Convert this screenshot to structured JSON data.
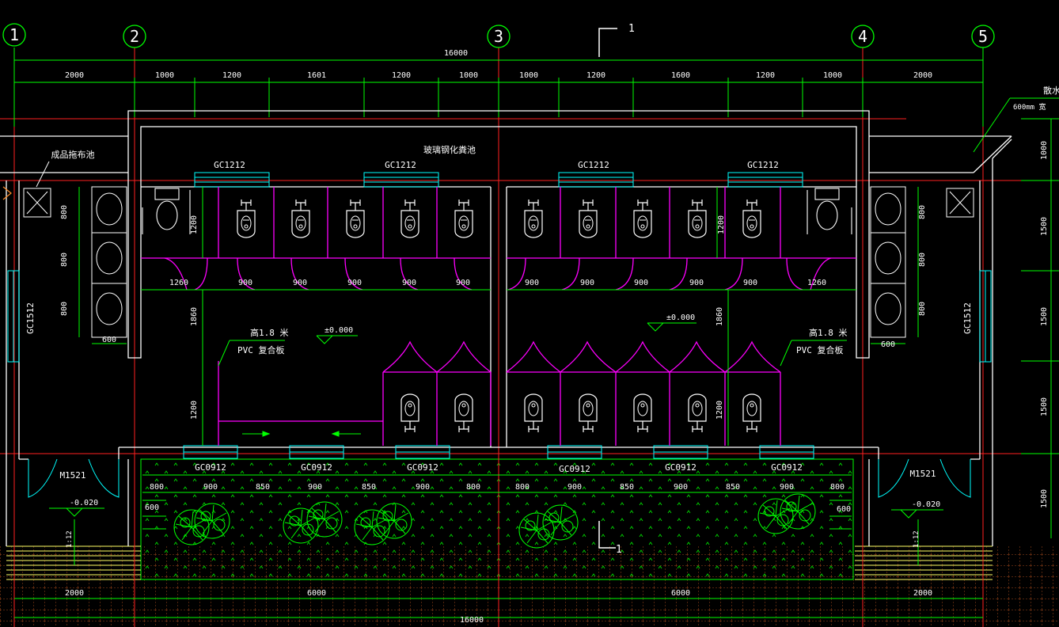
{
  "drawing": {
    "grid_labels": [
      "1",
      "2",
      "3",
      "4",
      "5"
    ],
    "section_mark": "1",
    "overall_dimension": "16000",
    "top_dimensions": [
      "2000",
      "1000",
      "1200",
      "1601",
      "1200",
      "1000",
      "1000",
      "1200",
      "1600",
      "1200",
      "1000",
      "2000"
    ],
    "bottom_dimensions": [
      "2000",
      "6000",
      "6000",
      "2000"
    ],
    "overall_dimension_bottom": "16000",
    "septic_tank_label": "玻璃钢化粪池",
    "top_windows": [
      "GC1212",
      "GC1212",
      "GC1212",
      "GC1212"
    ],
    "bottom_windows": [
      "GC0912",
      "GC0912",
      "GC0912",
      "GC0912",
      "GC0912",
      "GC0912"
    ],
    "side_windows": [
      "GC1512",
      "GC1512"
    ],
    "doors": [
      "M1521",
      "M1521"
    ],
    "mop_sink_label": "成品拖布池",
    "partition_note_line1": "高1.8 米",
    "partition_note_line2": "PVC 复合板",
    "partition_note_right_line1": "高1.8 米",
    "partition_note_right_line2": "PVC 复合板",
    "floor_level": "±0.000",
    "floor_level_right": "±0.000",
    "entrance_level": "-0.020",
    "entrance_level_right": "-0.020",
    "ramp_note": "1:12",
    "stall_widths_left": [
      "1260",
      "900",
      "900",
      "900",
      "900",
      "900"
    ],
    "stall_widths_right": [
      "900",
      "900",
      "900",
      "900",
      "900",
      "1260"
    ],
    "stall_depth": "1200",
    "stall_depth_right": "1200",
    "aisle_depth": "1860",
    "aisle_depth_right": "1860",
    "bottom_stall_depth": "1200",
    "bottom_stall_depth_right": "1200",
    "basin_spacing_left": [
      "800",
      "800",
      "800"
    ],
    "basin_spacing_right": [
      "800",
      "800",
      "800"
    ],
    "basin_width": "600",
    "basin_width_right": "600",
    "garden_dimensions": [
      "800",
      "900",
      "850",
      "900",
      "850",
      "900",
      "800",
      "800",
      "900",
      "850",
      "900",
      "850",
      "900",
      "800"
    ],
    "step_width": "600",
    "step_width_right": "600",
    "right_edge_dimensions": [
      "1000",
      "1500",
      "1500",
      "1500",
      "1500"
    ],
    "right_edge_note_line1": "散水",
    "right_edge_note_line2": "600mm 宽",
    "colors": {
      "green": "#00ff00",
      "magenta": "#ff00ff",
      "red": "#ff0000",
      "white": "#ffffff",
      "cyan": "#00ffff",
      "yellow": "#ffff66",
      "orange": "#ff8c2a"
    }
  }
}
